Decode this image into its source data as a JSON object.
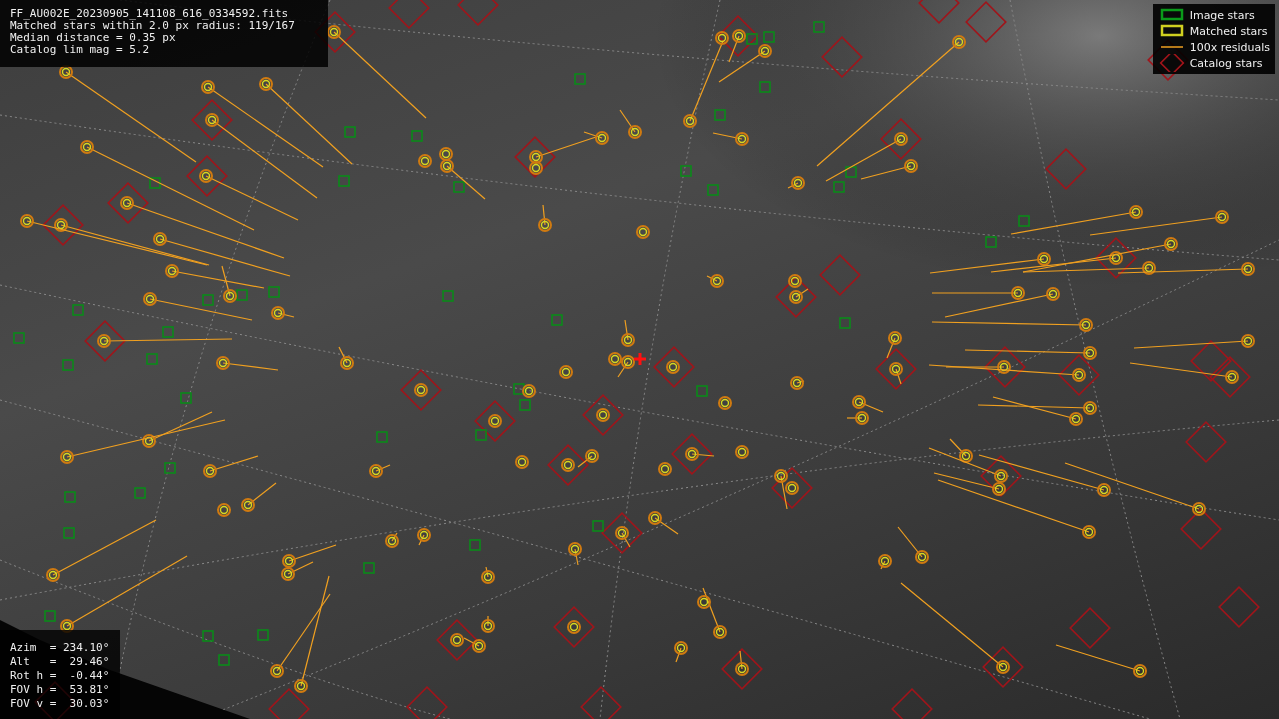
{
  "info_lines": [
    "FF_AU002E_20230905_141108_616_0334592.fits",
    "Matched stars within 2.0 px radius: 119/167",
    "Median distance = 0.35 px",
    "Catalog lim mag = 5.2"
  ],
  "legend": [
    {
      "kind": "image",
      "label": "Image stars"
    },
    {
      "kind": "matched",
      "label": "Matched stars"
    },
    {
      "kind": "residual",
      "label": "100x residuals"
    },
    {
      "kind": "catalog",
      "label": "Catalog stars"
    }
  ],
  "pointing_lines": [
    "Azim  = 234.10°",
    "Alt   =  29.46°",
    "Rot h =  -0.44°",
    "FOV h =  53.81°",
    "FOV v =  30.03°"
  ]
}
